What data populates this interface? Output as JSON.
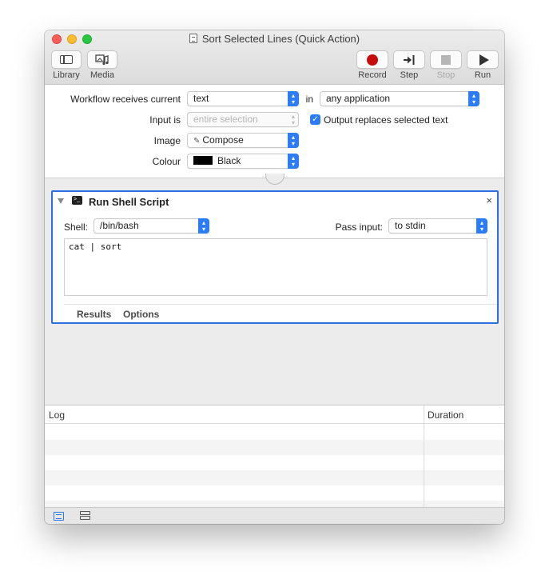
{
  "window": {
    "title": "Sort Selected Lines (Quick Action)"
  },
  "toolbar": {
    "library_label": "Library",
    "media_label": "Media",
    "record_label": "Record",
    "step_label": "Step",
    "stop_label": "Stop",
    "run_label": "Run"
  },
  "workflow": {
    "receives_label": "Workflow receives current",
    "receives_value": "text",
    "in_label": "in",
    "in_value": "any application",
    "input_is_label": "Input is",
    "input_is_value": "entire selection",
    "output_replaces_label": "Output replaces selected text",
    "output_replaces_checked": true,
    "image_label": "Image",
    "image_value": "Compose",
    "colour_label": "Colour",
    "colour_value": "Black",
    "colour_swatch": "#000000"
  },
  "action": {
    "title": "Run Shell Script",
    "shell_label": "Shell:",
    "shell_value": "/bin/bash",
    "pass_input_label": "Pass input:",
    "pass_input_value": "to stdin",
    "script": "cat | sort",
    "tabs": [
      "Results",
      "Options"
    ]
  },
  "log": {
    "col_log": "Log",
    "col_duration": "Duration"
  },
  "colors": {
    "accent": "#2c7cf7",
    "record": "#c70b0b",
    "selection_border": "#2c6fe3"
  }
}
